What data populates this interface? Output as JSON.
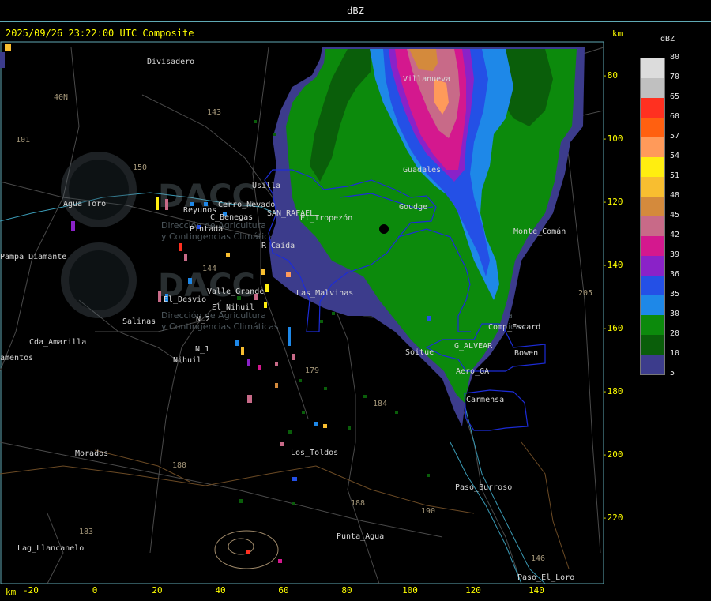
{
  "header": {
    "title": "dBZ"
  },
  "timestamp": "2025/09/26 23:22:00 UTC Composite",
  "units": {
    "km_top": "km",
    "km_bottom": "km"
  },
  "legend": {
    "title": "dBZ",
    "entries": [
      {
        "label": "80",
        "color": "#dcdcdc"
      },
      {
        "label": "70",
        "color": "#c0c0c0"
      },
      {
        "label": "65",
        "color": "#ff3020"
      },
      {
        "label": "60",
        "color": "#ff6010"
      },
      {
        "label": "57",
        "color": "#ff9a5a"
      },
      {
        "label": "54",
        "color": "#ffee10"
      },
      {
        "label": "51",
        "color": "#f8be30"
      },
      {
        "label": "48",
        "color": "#d48a3c"
      },
      {
        "label": "45",
        "color": "#c86a88"
      },
      {
        "label": "42",
        "color": "#d4188e"
      },
      {
        "label": "39",
        "color": "#8a22c8"
      },
      {
        "label": "36",
        "color": "#2450e6"
      },
      {
        "label": "35",
        "color": "#1e88e8"
      },
      {
        "label": "30",
        "color": "#0c8a0c"
      },
      {
        "label": "20",
        "color": "#0a5e0a"
      },
      {
        "label": "10",
        "color": "#3c3c8c"
      },
      {
        "label": "5",
        "color": "#3c3c8c"
      }
    ]
  },
  "axes": {
    "y_ticks": [
      "-80",
      "-100",
      "-120",
      "-140",
      "-160",
      "-180",
      "-200",
      "-220"
    ],
    "x_ticks": [
      "-20",
      "0",
      "20",
      "40",
      "60",
      "80",
      "100",
      "120",
      "140"
    ]
  },
  "watermark": {
    "brand": "DACC",
    "line1": "Dirección de Agricultura",
    "line2": "y Contingencias Climáticas"
  },
  "places": [
    "Divisadero",
    "Agua_Toro",
    "Pampa_Diamante",
    "El_Desvio",
    "Salinas",
    "Cda_Amarilla",
    "amentos",
    "Nihuil",
    "N_1",
    "N_2",
    "Valle_Grande",
    "Usilla",
    "C_Benegas",
    "SAN_RAFAEL",
    "R_Caida",
    "Las_Malvinas",
    "Reyunos",
    "Pintada",
    "Morados",
    "Los_Toldos",
    "Paso_Burroso",
    "Punta_Agua",
    "Lag_Llancanelo",
    "Soitue",
    "Bowen",
    "Carmensa",
    "Aero_GA",
    "G_ALVEAR",
    "Comp_Escard",
    "Guadales",
    "Villanueva",
    "Paso_El_Loro",
    "Monte_Comán",
    "Goudge",
    "El_Tropezón",
    "El_Nihuil",
    "Cerro_Nevado"
  ],
  "roads": [
    "143",
    "101",
    "40N",
    "150",
    "184",
    "179",
    "180",
    "183",
    "190",
    "205",
    "146",
    "188",
    "144"
  ]
}
